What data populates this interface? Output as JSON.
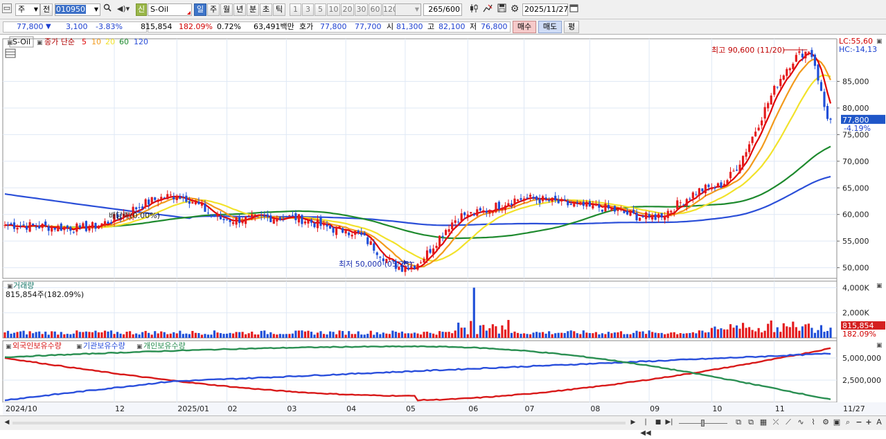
{
  "toolbar": {
    "type_label": "주",
    "prev_label": "전",
    "code": "010950",
    "credit_label": "신",
    "stock_name": "S-Oil",
    "periods": [
      "일",
      "주",
      "월",
      "년",
      "분",
      "초",
      "틱"
    ],
    "active_period": "일",
    "intervals": [
      "1",
      "3",
      "5",
      "10",
      "20",
      "30",
      "60",
      "120"
    ],
    "count": "265",
    "count_max": "/600",
    "date": "2025/11/27"
  },
  "quote": {
    "price": "77,800",
    "change_arrow": "▼",
    "change": "3,100",
    "change_pct": "-3.83%",
    "volume": "815,854",
    "volume_ratio": "182.09%",
    "turnover": "0.72%",
    "amount": "63,491백만",
    "hoga_label": "호가",
    "ask": "77,800",
    "bid": "77,700",
    "open_label": "시",
    "open": "81,300",
    "high_label": "고",
    "high": "82,100",
    "low_label": "저",
    "low": "76,800",
    "buy_label": "매수",
    "sell_label": "매도",
    "eval_label": "평"
  },
  "chart_data": [
    {
      "type": "candlestick",
      "panel": "price",
      "title": "S-Oil",
      "legend": [
        "종가 단순",
        "5",
        "10",
        "20",
        "60",
        "120"
      ],
      "ylim": [
        48000,
        93000
      ],
      "yticks": [
        50000,
        55000,
        60000,
        65000,
        70000,
        75000,
        80000,
        85000
      ],
      "ytick_labels": [
        "50,000",
        "55,000",
        "60,000",
        "65,000",
        "70,000",
        "75,000",
        "80,000",
        "85,000"
      ],
      "x_labels": [
        "2024/10",
        "12",
        "2025/01",
        "02",
        "03",
        "04",
        "05",
        "06",
        "07",
        "08",
        "09",
        "10",
        "11",
        "11/27"
      ],
      "ma_colors": {
        "5": "#e00000",
        "10": "#f29a1c",
        "20": "#f2e22a",
        "60": "#1e8a2e",
        "120": "#2b4fd8"
      },
      "up_color": "#e41a1c",
      "down_color": "#1f4fd8",
      "key_points": [
        {
          "date": "2024/10",
          "close": 58000
        },
        {
          "date": "2024/11",
          "close": 57500
        },
        {
          "date": "2025/01",
          "close": 63500
        },
        {
          "date": "2025/02",
          "close": 59000
        },
        {
          "date": "2025/03",
          "close": 59500
        },
        {
          "date": "2025/04",
          "close": 57000
        },
        {
          "date": "2025/05/23",
          "close": 50000
        },
        {
          "date": "2025/06",
          "close": 60000
        },
        {
          "date": "2025/07",
          "close": 63000
        },
        {
          "date": "2025/08",
          "close": 61500
        },
        {
          "date": "2025/09",
          "close": 59500
        },
        {
          "date": "2025/10",
          "close": 65000
        },
        {
          "date": "2025/11/20",
          "close": 90600
        },
        {
          "date": "2025/11/27",
          "close": 77800
        }
      ],
      "ma60_last": 69800,
      "ma120_last": 65300,
      "annotations": {
        "high": "최고 90,600 (11/20)",
        "low": "최저 50,000 (05/23)",
        "dividend": "배당락(0.00%)"
      },
      "lc_label": "LC:55,60",
      "hc_label": "HC:-14,13",
      "last_price_label": "77,800",
      "last_change_label": "-4.19%"
    },
    {
      "type": "bar",
      "panel": "volume",
      "title": "거래량",
      "current": "815,854주(182.09%)",
      "ylim": [
        0,
        4300000
      ],
      "yticks": [
        2000000,
        4000000
      ],
      "ytick_labels": [
        "2,000K",
        "4,000K"
      ],
      "peak": {
        "date": "2025/06",
        "value": 4000000
      },
      "last_label": "815,854",
      "last_pct": "182.09%"
    },
    {
      "type": "line",
      "panel": "holdings",
      "series": [
        {
          "name": "외국인보유수량",
          "color": "#d81919",
          "start": 5000000,
          "end": 6100000,
          "low": 250000
        },
        {
          "name": "기관보유수량",
          "color": "#2a4fdc",
          "start": 250000,
          "end": 5500000
        },
        {
          "name": "개인보유수량",
          "color": "#2a8f52",
          "start": 5100000,
          "end": 300000,
          "peak": 6300000
        }
      ],
      "ylim": [
        0,
        6800000
      ],
      "yticks": [
        2500000,
        5000000
      ],
      "ytick_labels": [
        "2,500,000",
        "5,000,000"
      ]
    }
  ]
}
